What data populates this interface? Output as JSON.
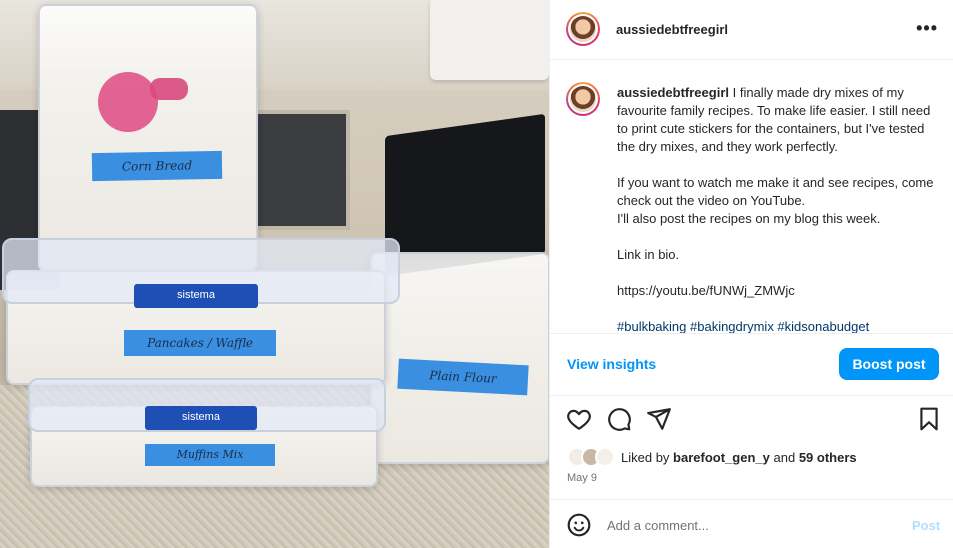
{
  "photo": {
    "labels": {
      "corn_bread": "Corn Bread",
      "pancakes": "Pancakes / Waffle",
      "muffins": "Muffins Mix",
      "plain_flour": "Plain Flour",
      "brand_top": "sistema",
      "brand_bottom": "sistema"
    }
  },
  "header": {
    "username": "aussiedebtfreegirl",
    "more_icon": "more-horizontal-icon"
  },
  "caption": {
    "username": "aussiedebtfreegirl",
    "line1": "I finally made dry mixes of my favourite family recipes. To make life easier. I still need to print cute stickers for the containers, but I've tested the dry mixes, and they work perfectly.",
    "line2": "If you want to watch me make it and see recipes, come check out the video on YouTube.\nI'll also post the recipes on my blog this week.",
    "line3": "Link in bio.",
    "line4": "https://youtu.be/fUNWj_ZMWjc",
    "hashtags": "#bulkbaking #bakingdrymix #kidsonabudget"
  },
  "actions": {
    "view_insights": "View insights",
    "boost_post": "Boost post"
  },
  "likes": {
    "prefix": "Liked by",
    "user": "barefoot_gen_y",
    "and": "and",
    "others": "59 others",
    "date": "May 9"
  },
  "comment": {
    "placeholder": "Add a comment...",
    "post_label": "Post"
  },
  "colors": {
    "accent": "#0095f6",
    "link": "#00376b",
    "muted": "#737373"
  }
}
